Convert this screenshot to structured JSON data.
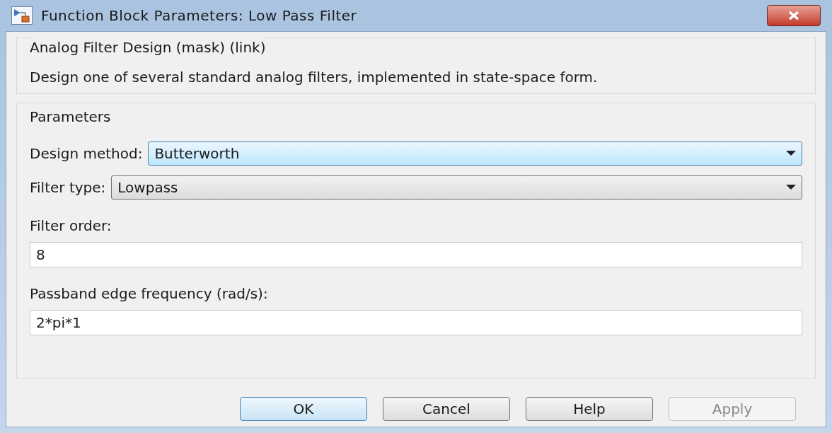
{
  "window": {
    "title": "Function Block Parameters: Low Pass Filter"
  },
  "description": {
    "title": "Analog Filter Design (mask) (link)",
    "text": "Design one of several standard analog filters, implemented in state-space form."
  },
  "parameters": {
    "title": "Parameters",
    "fields": [
      {
        "kind": "dropdown",
        "label": "Design method:",
        "value": "Butterworth",
        "focused": true
      },
      {
        "kind": "dropdown",
        "label": "Filter type:",
        "value": "Lowpass",
        "focused": false
      },
      {
        "kind": "text",
        "label": "Filter order:",
        "value": "8"
      },
      {
        "kind": "text",
        "label": "Passband edge frequency (rad/s):",
        "value": "2*pi*1"
      }
    ]
  },
  "buttons": [
    {
      "label": "OK",
      "default": true,
      "disabled": false
    },
    {
      "label": "Cancel",
      "default": false,
      "disabled": false
    },
    {
      "label": "Help",
      "default": false,
      "disabled": false
    },
    {
      "label": "Apply",
      "default": false,
      "disabled": true
    }
  ]
}
